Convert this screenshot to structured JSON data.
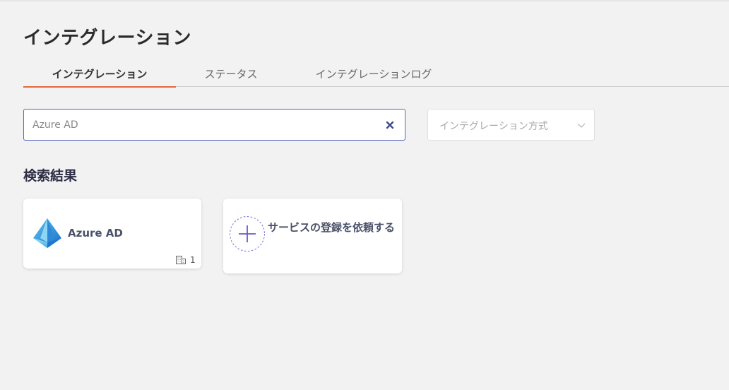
{
  "page": {
    "title": "インテグレーション"
  },
  "tabs": [
    {
      "label": "インテグレーション",
      "active": true
    },
    {
      "label": "ステータス",
      "active": false
    },
    {
      "label": "インテグレーションログ",
      "active": false
    }
  ],
  "search": {
    "value": "Azure AD",
    "clear_icon": "close-icon"
  },
  "filter": {
    "placeholder": "インテグレーション方式",
    "icon": "chevron-down-icon"
  },
  "results": {
    "heading": "検索結果",
    "cards": [
      {
        "name": "Azure AD",
        "icon": "azure-ad-logo",
        "org_count": "1",
        "org_icon": "building-icon"
      },
      {
        "label": "サービスの登録を依頼する",
        "icon": "plus-icon"
      }
    ]
  },
  "colors": {
    "tab_underline": "#e2673d",
    "search_border": "#5566bb",
    "accent": "#6a5acd"
  }
}
